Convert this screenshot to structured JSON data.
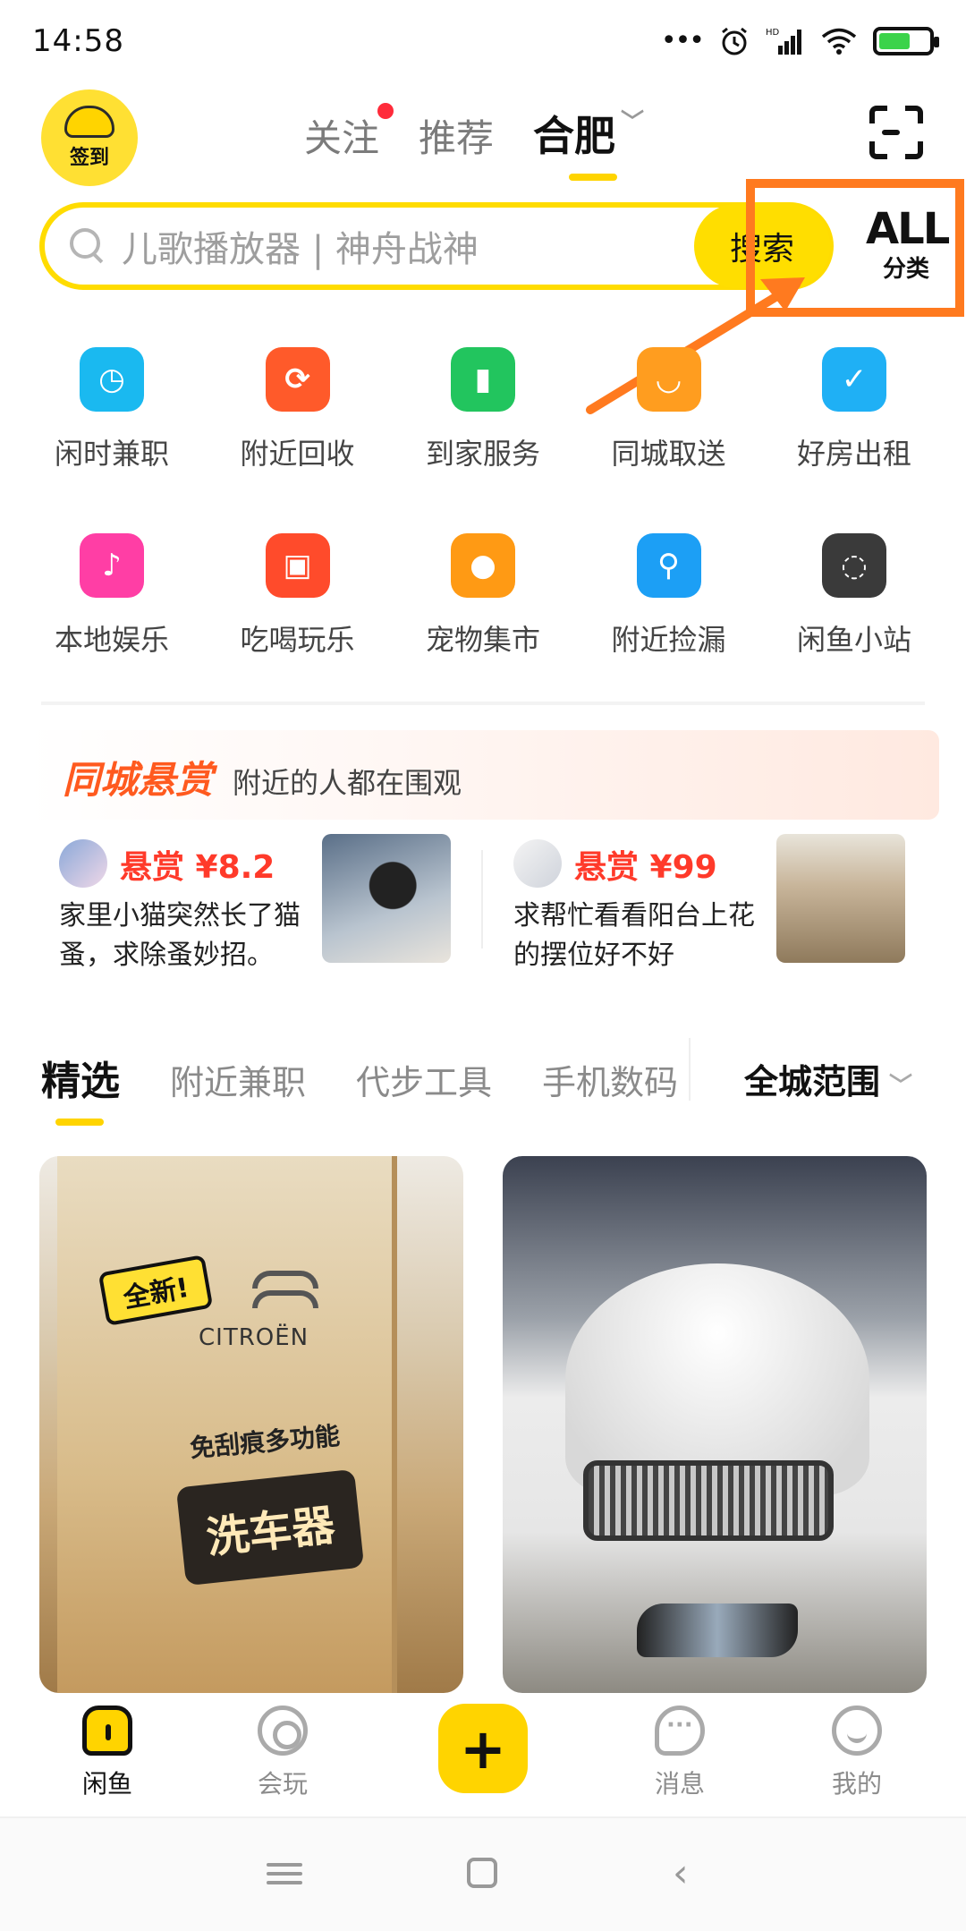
{
  "status_bar": {
    "time": "14:58",
    "icons": [
      "more-dots-icon",
      "alarm-icon",
      "hd-signal-icon",
      "wifi-icon",
      "battery-charging-icon"
    ]
  },
  "header": {
    "signin_label": "签到",
    "tabs": [
      {
        "label": "关注",
        "has_dot": true
      },
      {
        "label": "推荐"
      },
      {
        "label": "合肥",
        "active": true
      }
    ],
    "scan_icon": "scan-icon"
  },
  "search": {
    "placeholder": "儿歌播放器 | 神舟战神",
    "button_label": "搜索",
    "all_big": "ALL",
    "all_small": "分类",
    "accent": "#ffdc00"
  },
  "annotation": {
    "color": "#ff7a1f"
  },
  "grid": {
    "row1": [
      {
        "label": "闲时兼职",
        "icon": "briefcase-icon"
      },
      {
        "label": "附近回收",
        "icon": "recycle-icon"
      },
      {
        "label": "到家服务",
        "icon": "door-icon"
      },
      {
        "label": "同城取送",
        "icon": "package-icon"
      },
      {
        "label": "好房出租",
        "icon": "house-check-icon"
      }
    ],
    "row2": [
      {
        "label": "本地娱乐",
        "icon": "microphone-icon"
      },
      {
        "label": "吃喝玩乐",
        "icon": "shopping-bag-icon"
      },
      {
        "label": "宠物集市",
        "icon": "pet-icon"
      },
      {
        "label": "附近捡漏",
        "icon": "magnifier-icon"
      },
      {
        "label": "闲鱼小站",
        "icon": "station-icon"
      }
    ]
  },
  "bounty": {
    "title": "同城悬赏",
    "subtitle": "附近的人都在围观",
    "items": [
      {
        "reward": "悬赏 ¥8.2",
        "desc": "家里小猫突然长了猫蚤，求除蚤妙招。"
      },
      {
        "reward": "悬赏 ¥99",
        "desc": "求帮忙看看阳台上花的摆位好不好"
      }
    ]
  },
  "feed": {
    "tabs": [
      "精选",
      "附近兼职",
      "代步工具",
      "手机数码"
    ],
    "range_label": "全城范围"
  },
  "cards": {
    "left": {
      "badge": "全新!",
      "brand": "CITROËN",
      "subtitle": "免刮痕多功能",
      "product": "洗车器"
    }
  },
  "bottom_nav": {
    "items": [
      {
        "label": "闲鱼",
        "active": true
      },
      {
        "label": "会玩"
      },
      {
        "label": "消息"
      },
      {
        "label": "我的"
      }
    ],
    "publish": "+"
  }
}
